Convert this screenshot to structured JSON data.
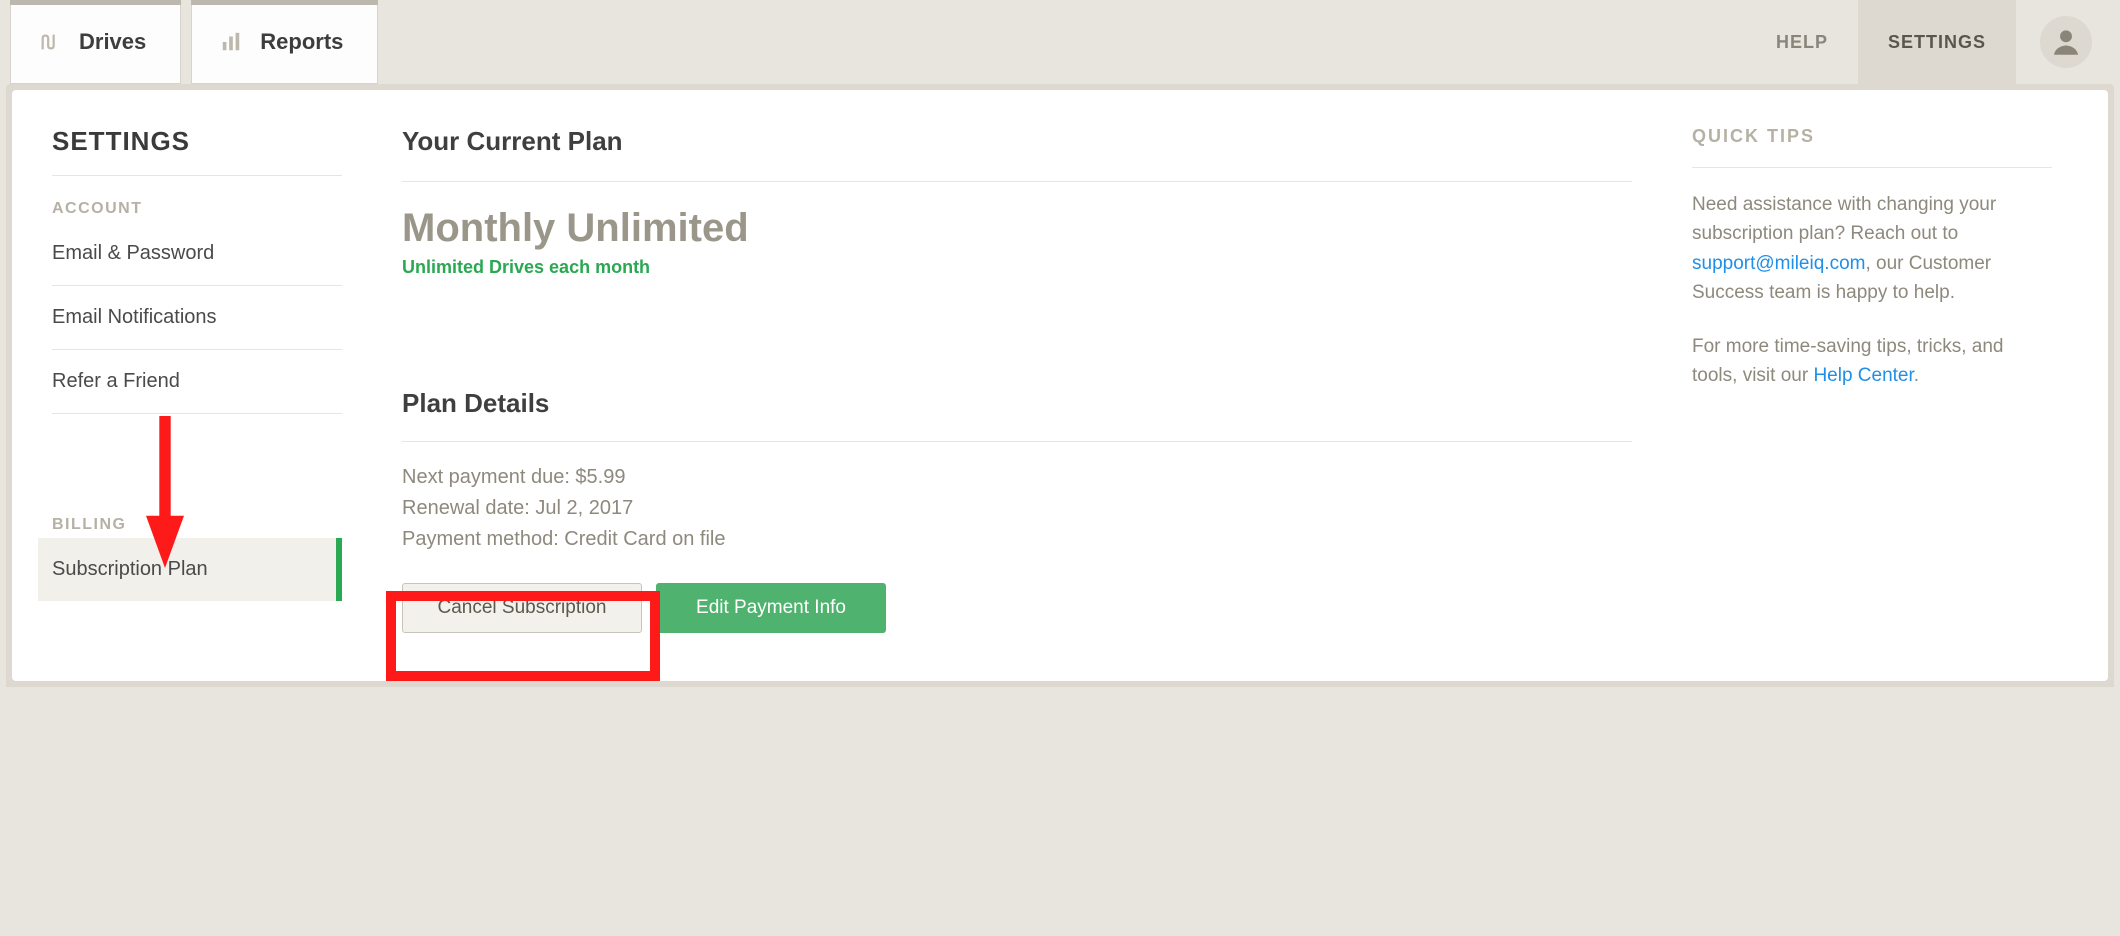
{
  "nav": {
    "tabs": [
      {
        "label": "Drives"
      },
      {
        "label": "Reports"
      }
    ],
    "help": "HELP",
    "settings": "SETTINGS"
  },
  "sidebar": {
    "title": "SETTINGS",
    "account_label": "ACCOUNT",
    "items": {
      "email_password": "Email & Password",
      "email_notifications": "Email Notifications",
      "refer_friend": "Refer a Friend"
    },
    "billing_label": "BILLING",
    "subscription_plan": "Subscription Plan"
  },
  "main": {
    "current_plan_heading": "Your Current Plan",
    "plan_name": "Monthly Unlimited",
    "plan_sub": "Unlimited Drives each month",
    "plan_details_heading": "Plan Details",
    "detail_next_payment": "Next payment due: $5.99",
    "detail_renewal": "Renewal date: Jul 2, 2017",
    "detail_method": "Payment method: Credit Card on file",
    "cancel_label": "Cancel Subscription",
    "edit_label": "Edit Payment Info"
  },
  "tips": {
    "title": "QUICK TIPS",
    "p1_a": "Need assistance with changing your subscription plan? Reach out to ",
    "p1_link": "support@mileiq.com",
    "p1_b": ", our Customer Success team is happy to help.",
    "p2_a": "For more time-saving tips, tricks, and tools, visit our ",
    "p2_link": "Help Center",
    "p2_b": "."
  }
}
